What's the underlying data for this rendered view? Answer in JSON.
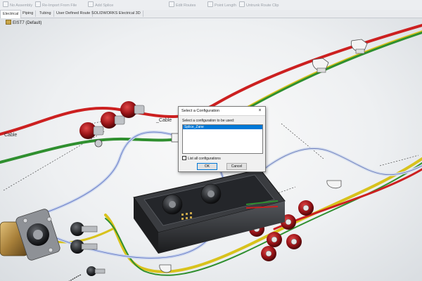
{
  "toolbar": {
    "items": [
      "No Assembly",
      "Re-Import From File",
      "Add Splice",
      "Edit Routes",
      "Point Length",
      "Untrunk Route Clip"
    ]
  },
  "tabs": [
    {
      "label": "Electrical",
      "active": true
    },
    {
      "label": "Piping",
      "active": false
    },
    {
      "label": "Tubing",
      "active": false
    },
    {
      "label": "User Defined Route",
      "active": false
    },
    {
      "label": "SOLIDWORKS Electrical 3D",
      "active": false
    }
  ],
  "feature_tree": {
    "label": "EIST7 (Default)"
  },
  "cable_labels": {
    "left": "Cable",
    "middle": "_Cable"
  },
  "dialog": {
    "title": "Select a Configuration",
    "prompt": "Select a configuration to be used:",
    "list_items": [
      "Splice_Zane"
    ],
    "selected_index": 0,
    "checkbox_label": "List all configurations",
    "checkbox_checked": false,
    "ok_label": "OK",
    "cancel_label": "Cancel",
    "close_glyph": "×"
  },
  "colors": {
    "accent": "#0078d7",
    "wire_red": "#cc2020",
    "wire_green": "#2f8f2f",
    "wire_yellow": "#d8c21c",
    "connector_red": "#9b1418",
    "enclosure": "#2a2c2f"
  }
}
